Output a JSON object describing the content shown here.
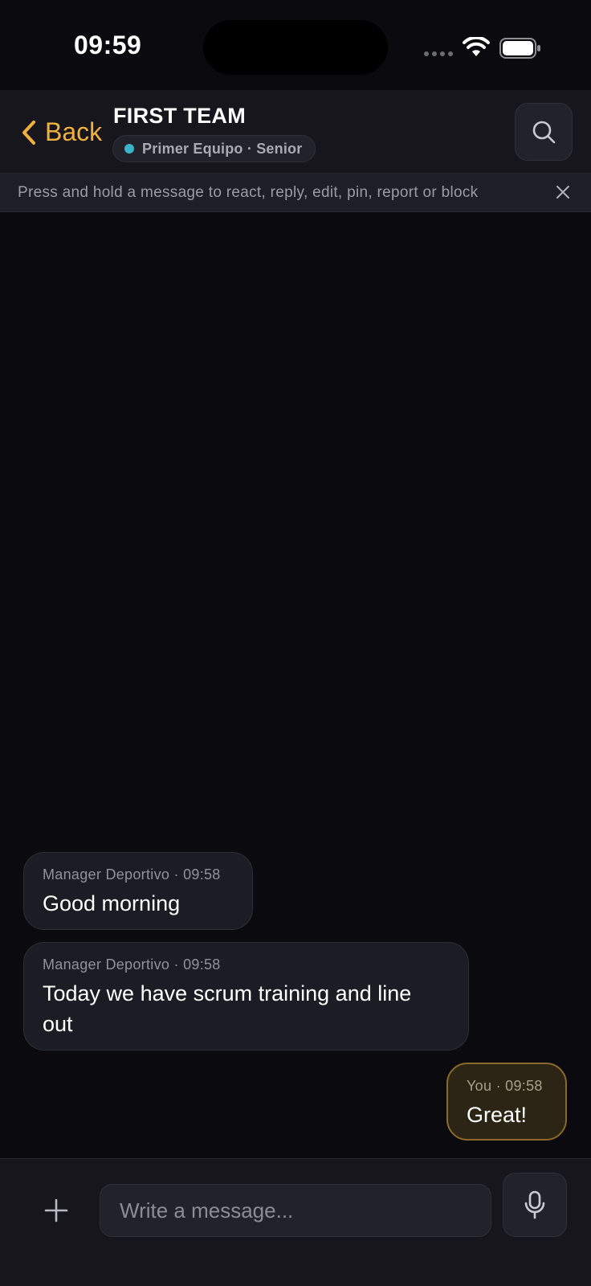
{
  "status_bar": {
    "time": "09:59"
  },
  "header": {
    "back_label": "Back",
    "title": "FIRST TEAM",
    "team_label": "Primer Equipo · Senior",
    "team_dot_color": "#3ab4c9",
    "search_icon": "search-icon"
  },
  "hint": {
    "text": "Press and hold a message to react, reply, edit, pin, report or block",
    "close_icon": "close-icon"
  },
  "messages": [
    {
      "sender": "Manager Deportivo",
      "time": "09:58",
      "meta": "Manager Deportivo · 09:58",
      "text": "Good morning",
      "own": false
    },
    {
      "sender": "Manager Deportivo",
      "time": "09:58",
      "meta": "Manager Deportivo · 09:58",
      "text": "Today we have scrum training and line out",
      "own": false
    },
    {
      "sender": "You",
      "time": "09:58",
      "meta": "You · 09:58",
      "text": "Great!",
      "own": true
    }
  ],
  "composer": {
    "placeholder": "Write a message...",
    "value": "",
    "add_icon": "plus-icon",
    "mic_icon": "microphone-icon"
  },
  "colors": {
    "accent": "#f0b23b",
    "background": "#0b0b0f",
    "surface": "#16161c",
    "own_bubble": "#2c2516",
    "own_bubble_border": "#8a6a2a"
  }
}
